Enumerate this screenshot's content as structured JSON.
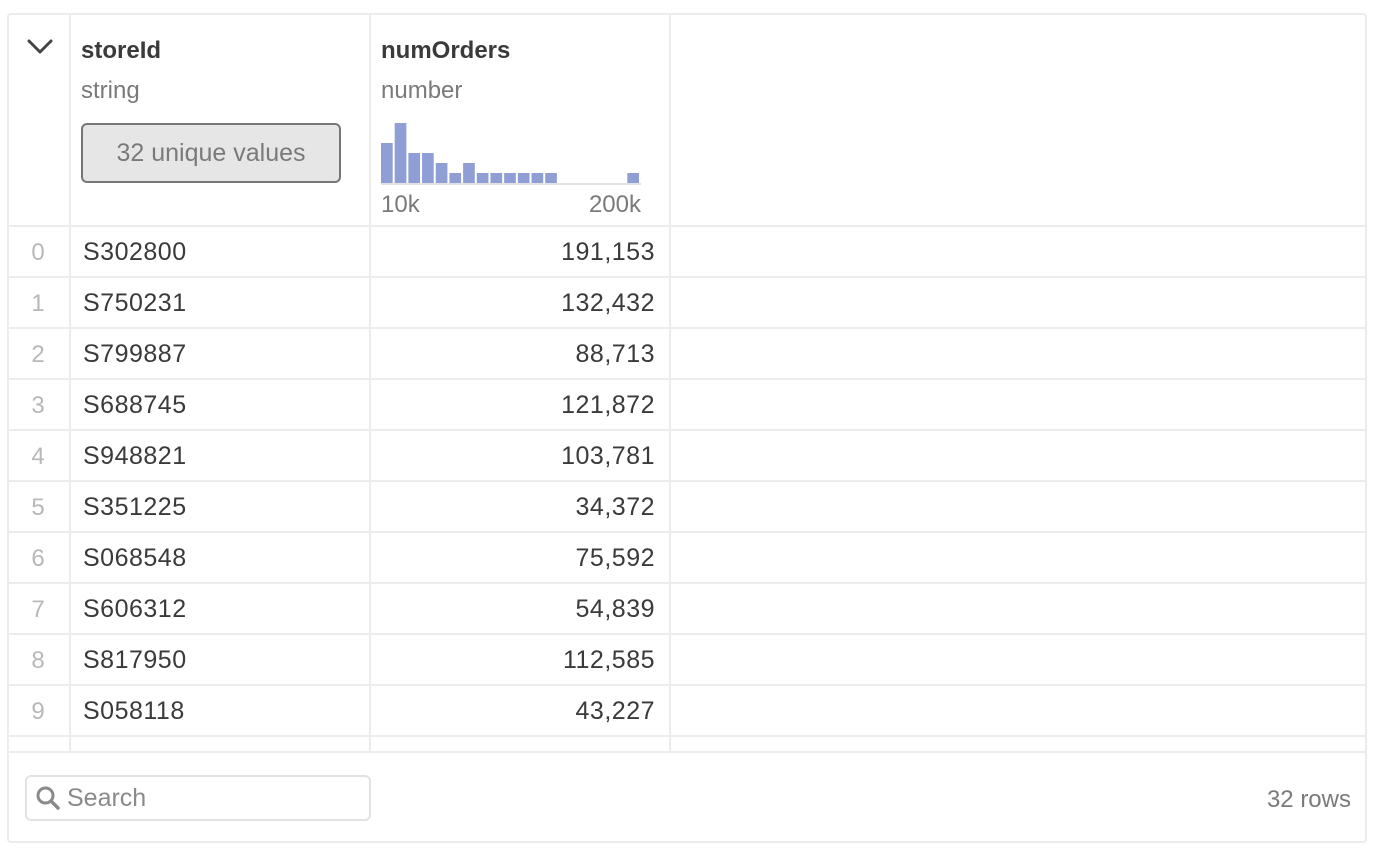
{
  "columns": {
    "storeId": {
      "title": "storeId",
      "type": "string",
      "summary": "32 unique values"
    },
    "numOrders": {
      "title": "numOrders",
      "type": "number",
      "hist_min_label": "10k",
      "hist_max_label": "200k"
    }
  },
  "rows": [
    {
      "index": "0",
      "storeId": "S302800",
      "numOrders": "191,153"
    },
    {
      "index": "1",
      "storeId": "S750231",
      "numOrders": "132,432"
    },
    {
      "index": "2",
      "storeId": "S799887",
      "numOrders": "88,713"
    },
    {
      "index": "3",
      "storeId": "S688745",
      "numOrders": "121,872"
    },
    {
      "index": "4",
      "storeId": "S948821",
      "numOrders": "103,781"
    },
    {
      "index": "5",
      "storeId": "S351225",
      "numOrders": "34,372"
    },
    {
      "index": "6",
      "storeId": "S068548",
      "numOrders": "75,592"
    },
    {
      "index": "7",
      "storeId": "S606312",
      "numOrders": "54,839"
    },
    {
      "index": "8",
      "storeId": "S817950",
      "numOrders": "112,585"
    },
    {
      "index": "9",
      "storeId": "S058118",
      "numOrders": "43,227"
    }
  ],
  "chart_data": {
    "type": "bar",
    "xlim_labels": [
      "10k",
      "200k"
    ],
    "bins": 19,
    "values": [
      4,
      6,
      3,
      3,
      2,
      1,
      2,
      1,
      1,
      1,
      1,
      1,
      1,
      0,
      0,
      0,
      0,
      0,
      1
    ]
  },
  "footer": {
    "search_placeholder": "Search",
    "row_count": "32 rows"
  },
  "colors": {
    "histogram_bar": "#8f9fd6",
    "grid_line": "#ececec"
  },
  "icons": {
    "collapse": "chevron-down-icon",
    "search": "search-icon"
  }
}
